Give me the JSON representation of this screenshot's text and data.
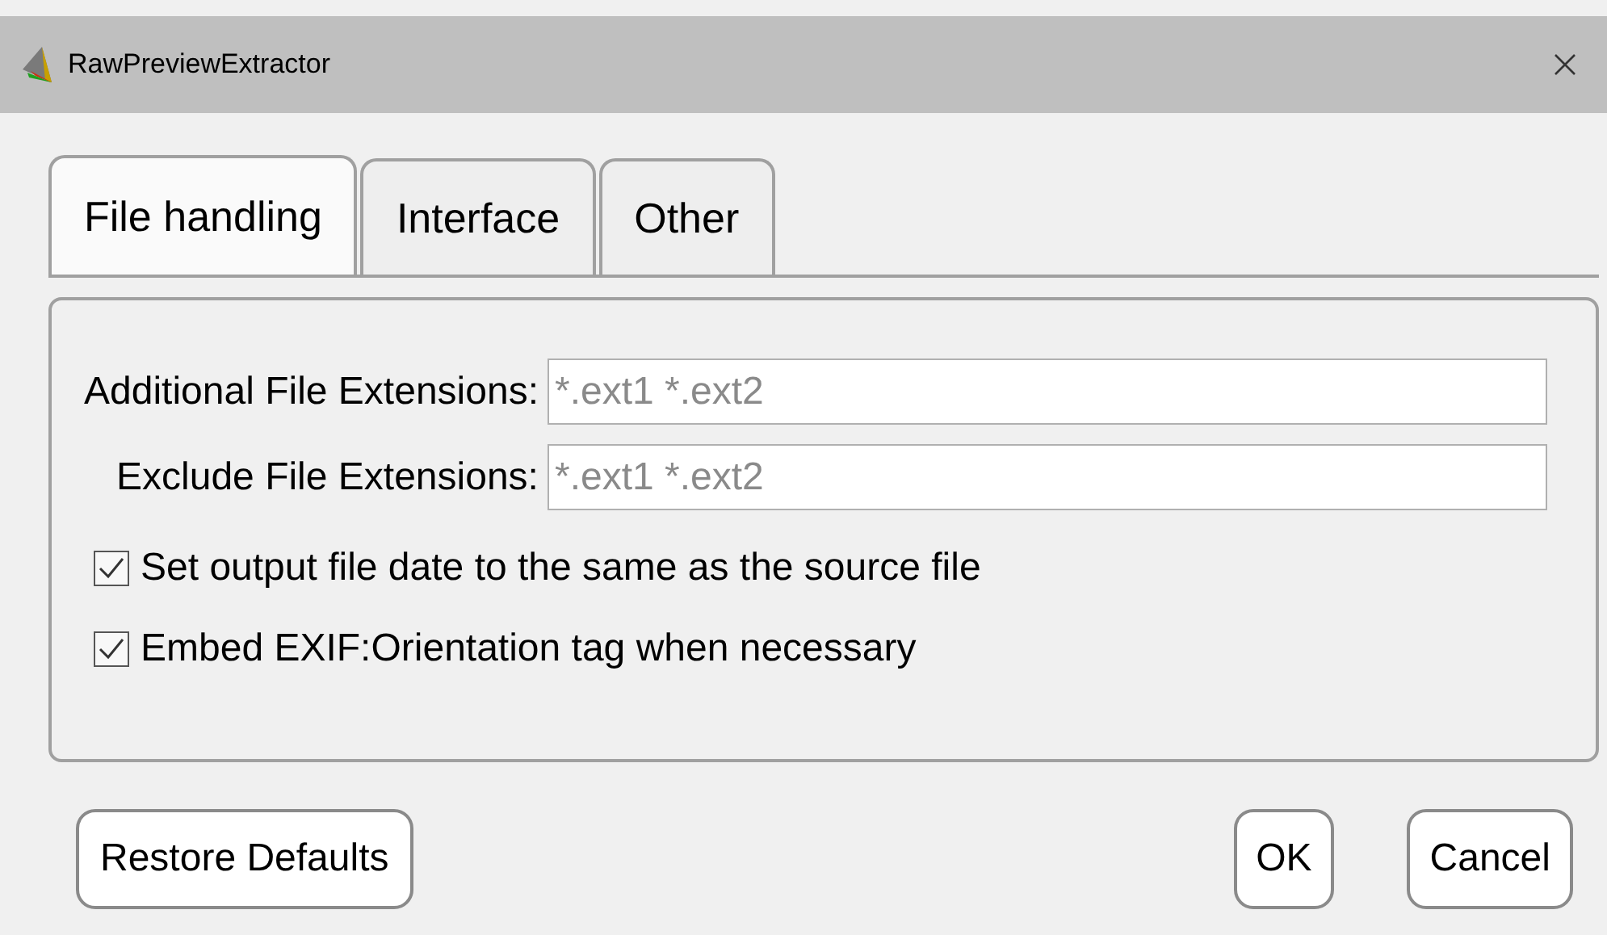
{
  "window": {
    "title": "RawPreviewExtractor"
  },
  "tabs": [
    {
      "label": "File handling",
      "selected": true
    },
    {
      "label": "Interface",
      "selected": false
    },
    {
      "label": "Other",
      "selected": false
    }
  ],
  "fields": [
    {
      "label": "Additional File Extensions:",
      "placeholder": "*.ext1 *.ext2"
    },
    {
      "label": "Exclude File Extensions:",
      "placeholder": "*.ext1 *.ext2"
    }
  ],
  "checkboxes": [
    {
      "label": "Set output file date to the same as the source file",
      "checked": true
    },
    {
      "label": "Embed EXIF:Orientation tag when necessary",
      "checked": true
    }
  ],
  "buttons": {
    "left": [
      "Restore Defaults"
    ],
    "right": [
      "OK",
      "Cancel"
    ]
  }
}
